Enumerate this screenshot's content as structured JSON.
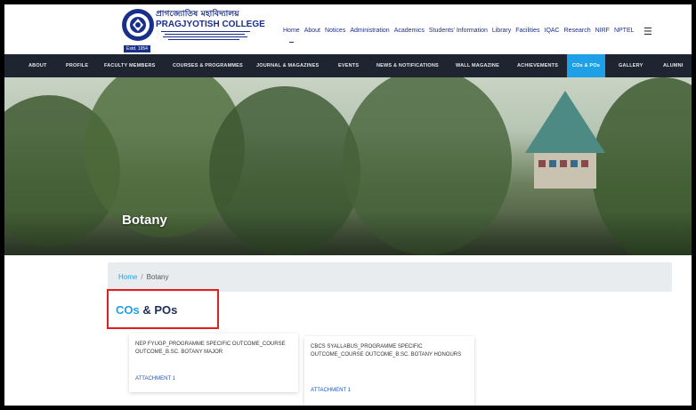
{
  "header": {
    "logo_bengali": "প্ৰাগজ্যোতিষ মহাবিদ্যালয়",
    "logo_name": "PRAGJYOTISH COLLEGE",
    "logo_estd": "Estd. 1954",
    "topnav": [
      "Home",
      "About",
      "Notices",
      "Administration",
      "Academics",
      "Students' Information",
      "Library",
      "Facilities",
      "IQAC",
      "Research",
      "NIRF",
      "NPTEL"
    ]
  },
  "menubar": [
    "ABOUT",
    "PROFILE",
    "FACULTY MEMBERS",
    "COURSES & PROGRAMMES",
    "JOURNAL & MAGAZINES",
    "EVENTS",
    "NEWS & NOTIFICATIONS",
    "WALL MAGAZINE",
    "ACHIEVEMENTS",
    "COs & POs",
    "GALLERY",
    "ALUMNI"
  ],
  "menubar_active": "COs & POs",
  "hero": {
    "title": "Botany"
  },
  "breadcrumb": {
    "home": "Home",
    "separator": "/",
    "current": "Botany"
  },
  "section": {
    "heading_cos": "COs",
    "heading_rest": " & POs"
  },
  "cards": [
    {
      "title": "NEP FYUGP_PROGRAMME SPECIFIC OUTCOME_COURSE OUTCOME_B.Sc. Botany Major",
      "attachment": "ATTACHMENT 1"
    },
    {
      "title": "CBCS Syallabus_PROGRAMME SPECIFIC OUTCOME_COURSE OUTCOME_B.SC. BOTANY HONOURS",
      "attachment": "ATTACHMENT 1"
    }
  ],
  "colors": {
    "accent": "#1fa0e6",
    "menubar": "#1e2530",
    "highlight_box": "#e41d1d",
    "brand": "#1a2f8a"
  }
}
